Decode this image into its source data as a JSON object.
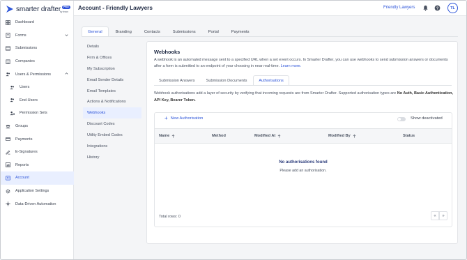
{
  "brand": {
    "name": "smarter drafter",
    "badge": "PRO",
    "sub": "by lexon",
    "accent": "#2d55d9"
  },
  "sidebar": {
    "items": [
      {
        "label": "Dashboard",
        "icon": "grid-icon",
        "sub": false
      },
      {
        "label": "Forms",
        "icon": "form-icon",
        "sub": false,
        "chevron": "down"
      },
      {
        "label": "Submissions",
        "icon": "stack-icon",
        "sub": false
      },
      {
        "label": "Companies",
        "icon": "building-icon",
        "sub": false
      },
      {
        "label": "Users & Permissions",
        "icon": "users-icon",
        "sub": false,
        "chevron": "up"
      },
      {
        "label": "Users",
        "icon": "users-icon",
        "sub": true
      },
      {
        "label": "End-Users",
        "icon": "users-icon",
        "sub": true
      },
      {
        "label": "Permission Sets",
        "icon": "permission-icon",
        "sub": true
      },
      {
        "label": "Groups",
        "icon": "groups-icon",
        "sub": false
      },
      {
        "label": "Payments",
        "icon": "payment-icon",
        "sub": false
      },
      {
        "label": "E-Signatures",
        "icon": "signature-icon",
        "sub": false
      },
      {
        "label": "Reports",
        "icon": "report-icon",
        "sub": false
      },
      {
        "label": "Account",
        "icon": "account-icon",
        "sub": false,
        "active": true
      },
      {
        "label": "Application Settings",
        "icon": "gear-icon",
        "sub": false
      },
      {
        "label": "Data-Driven Automation",
        "icon": "automation-icon",
        "sub": false
      }
    ]
  },
  "header": {
    "title": "Account - Friendly Lawyers",
    "org": "Friendly Lawyers",
    "avatar": "TL"
  },
  "top_tabs": [
    {
      "label": "General",
      "active": true
    },
    {
      "label": "Branding"
    },
    {
      "label": "Contacts"
    },
    {
      "label": "Submissions"
    },
    {
      "label": "Portal"
    },
    {
      "label": "Payments"
    }
  ],
  "settings_menu": [
    {
      "label": "Details"
    },
    {
      "label": "Firm & Offices"
    },
    {
      "label": "My Subscription"
    },
    {
      "label": "Email Sender Details"
    },
    {
      "label": "Email Templates"
    },
    {
      "label": "Actions & Notifications"
    },
    {
      "label": "Webhooks",
      "active": true
    },
    {
      "label": "Discount Codes"
    },
    {
      "label": "Utility Embed Codes"
    },
    {
      "label": "Integrations"
    },
    {
      "label": "History"
    }
  ],
  "webhooks": {
    "title": "Webhooks",
    "desc": "A webhook is an automated message sent to a specified URL when a set event occurs. In Smarter Drafter, you can use webhooks to send submission answers or documents after a form is submitted to an endpoint of your choosing in near real-time.",
    "learn_more": "Learn more.",
    "sub_tabs": [
      {
        "label": "Submission Answers"
      },
      {
        "label": "Submission Documents"
      },
      {
        "label": "Authorisations",
        "active": true
      }
    ],
    "auth_desc_prefix": "Webhook authorisations add a layer of security by verifying that incoming requests are from Smarter Drafter. Supported authorisation types are ",
    "auth_types": "No Auth, Basic Authentication, API Key, Bearer Token.",
    "new_button": "New Authorisation",
    "toggle_label": "Show deactivated",
    "toggle_on": false,
    "columns": [
      "Name",
      "Method",
      "Modified At",
      "Modified By",
      "Status"
    ],
    "empty_title": "No authorisations found",
    "empty_sub": "Please add an authorisation.",
    "total_rows": "Total rows: 0",
    "prev": "«",
    "next": "»"
  }
}
